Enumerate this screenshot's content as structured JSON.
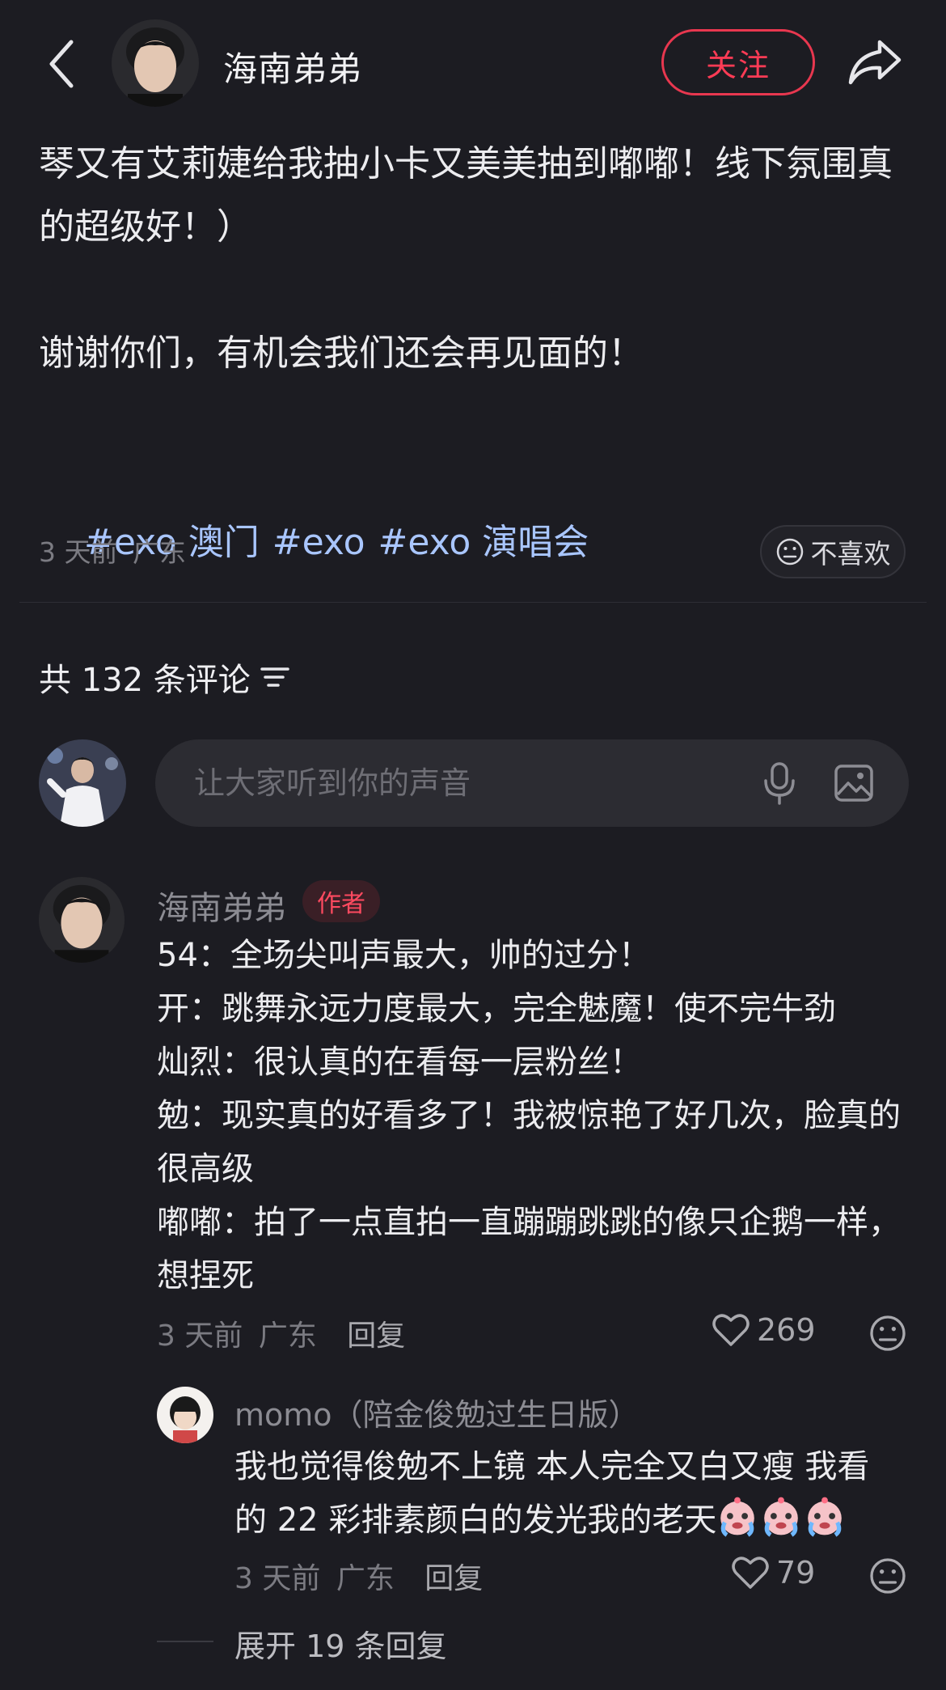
{
  "header": {
    "author_name": "海南弟弟",
    "follow_label": "关注"
  },
  "post": {
    "paragraph1": "琴又有艾莉婕给我抽小卡又美美抽到嘟嘟！线下氛围真的超级好！）",
    "paragraph2": "谢谢你们，有机会我们还会再见面的！",
    "tags": [
      "#exo 澳门",
      "#exo",
      "#exo 演唱会"
    ],
    "time": "3 天前",
    "location": "广东",
    "dislike_label": "不喜欢"
  },
  "comments_section": {
    "count_label": "共 132 条评论",
    "input_placeholder": "让大家听到你的声音"
  },
  "comment": {
    "name": "海南弟弟",
    "badge": "作者",
    "lines": [
      "54：全场尖叫声最大，帅的过分！",
      "开：跳舞永远力度最大，完全魅魔！使不完牛劲",
      "灿烈：很认真的在看每一层粉丝！",
      "勉：现实真的好看多了！我被惊艳了好几次，脸真的很高级",
      "嘟嘟：拍了一点直拍一直蹦蹦跳跳的像只企鹅一样，想捏死"
    ],
    "time": "3 天前",
    "location": "广东",
    "reply_label": "回复",
    "likes": "269"
  },
  "reply": {
    "name": "momo（陪金俊勉过生日版）",
    "text": "我也觉得俊勉不上镜 本人完全又白又瘦 我看的 22 彩排素颜白的发光我的老天",
    "time": "3 天前",
    "location": "广东",
    "reply_label": "回复",
    "likes": "79"
  },
  "expand_label": "展开 19 条回复",
  "colors": {
    "background": "#1c1c22",
    "accent": "#ff3b55",
    "tag": "#a9c6ff"
  }
}
